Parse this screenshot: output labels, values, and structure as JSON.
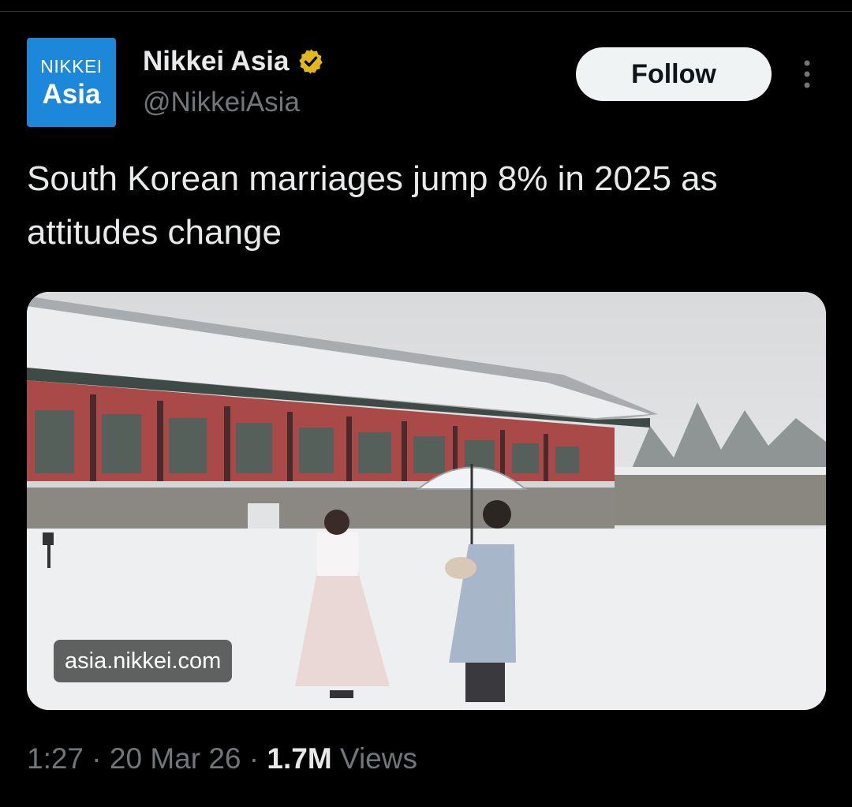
{
  "account": {
    "avatar_line1": "NIKKEI",
    "avatar_line2": "Asia",
    "display_name": "Nikkei Asia",
    "handle": "@NikkeiAsia",
    "verified_icon": "gold-verified-badge"
  },
  "actions": {
    "follow_label": "Follow",
    "more_icon": "vertical-ellipsis"
  },
  "tweet": {
    "text": "South Korean marriages jump 8% in 2025 as attitudes change"
  },
  "media": {
    "source_label": "asia.nikkei.com"
  },
  "meta": {
    "time": "1:27",
    "sep1": " · ",
    "date": "20 Mar 26",
    "sep2": " · ",
    "views_count": "1.7M",
    "views_label": " Views"
  },
  "colors": {
    "background": "#000000",
    "text_primary": "#e7e9ea",
    "text_secondary": "#71767b",
    "avatar_blue": "#1d87d9",
    "verified_gold": "#e2b719",
    "follow_bg": "#eff3f4"
  }
}
